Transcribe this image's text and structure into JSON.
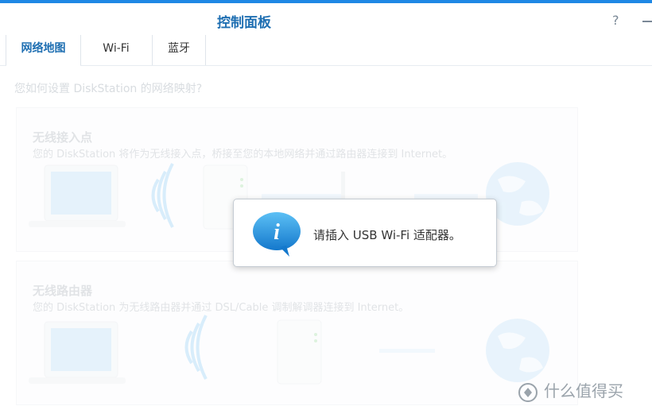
{
  "window": {
    "title": "控制面板",
    "help_icon": "help-icon",
    "minimize_icon": "minimize-icon"
  },
  "tabs": [
    {
      "label": "网络地图",
      "active": true
    },
    {
      "label": "Wi-Fi",
      "active": false
    },
    {
      "label": "蓝牙",
      "active": false
    }
  ],
  "main": {
    "question": "您如何设置 DiskStation 的网络映射?",
    "options": [
      {
        "title": "无线接入点",
        "description": "您的 DiskStation 将作为无线接入点，桥接至您的本地网络并通过路由器连接到 Internet。"
      },
      {
        "title": "无线路由器",
        "description": "您的 DiskStation 为无线路由器并通过 DSL/Cable 调制解调器连接到 Internet。"
      }
    ]
  },
  "dialog": {
    "message": "请插入 USB Wi-Fi 适配器。",
    "icon": "info-icon"
  },
  "watermark": {
    "text": "什么值得买",
    "logo": "value-logo"
  },
  "colors": {
    "accent": "#1e88e5",
    "title": "#1f6fb2"
  }
}
